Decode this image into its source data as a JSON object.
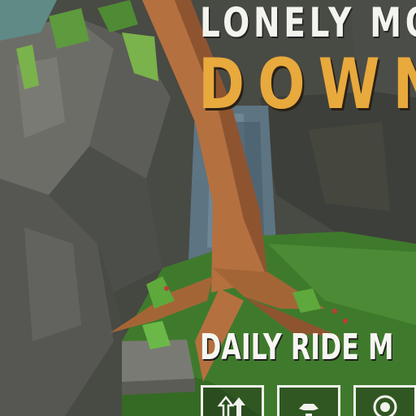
{
  "title": {
    "line1": "LONELY MO",
    "line2": "DOWN"
  },
  "menu": {
    "subtitle": "DAILY RIDE M",
    "buttons": [
      {
        "icon": "arrows-up-icon"
      },
      {
        "icon": "bike-icon"
      },
      {
        "icon": "trophy-icon"
      }
    ]
  },
  "colors": {
    "title_white": "#f4f4ef",
    "title_orange": "#e8a93d",
    "grass": "#3f7a2c",
    "rock": "#5a5a55",
    "trunk": "#b5703f",
    "water": "#5d7482"
  }
}
